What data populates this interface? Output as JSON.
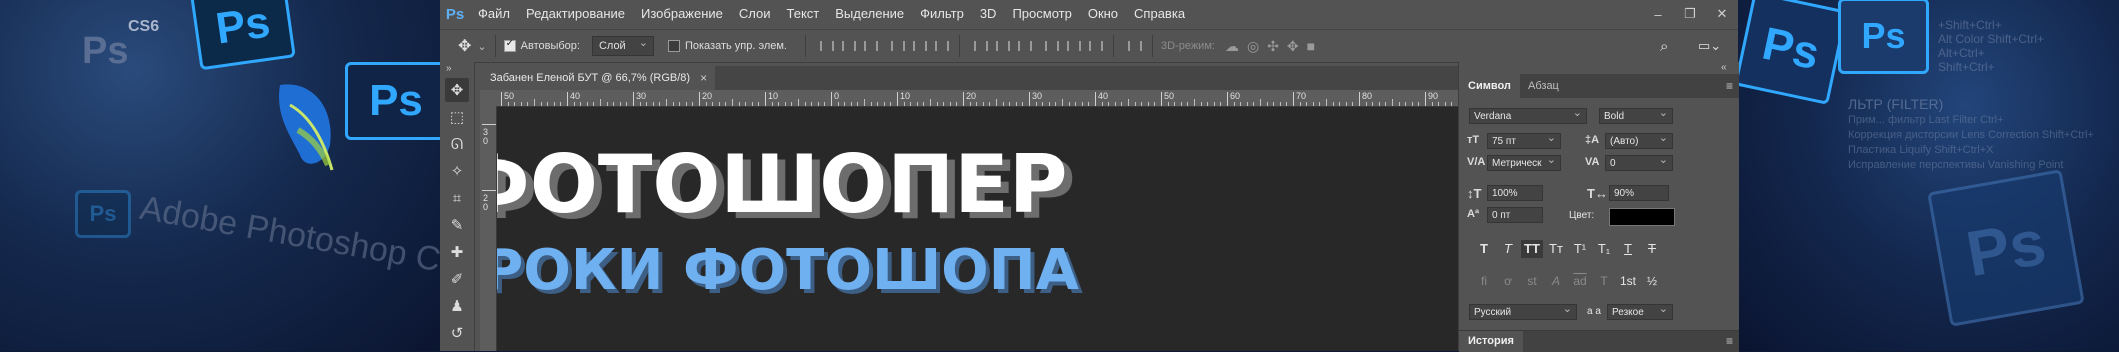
{
  "background": {
    "left_badges": [
      "CS6",
      "Ps",
      "Ps",
      "Ps",
      "Ps"
    ],
    "left_text": "Adobe Photoshop C",
    "right_badges": [
      "Ps",
      "Ps",
      "Ps"
    ],
    "right_text_lines": [
      "+Shift+Ctrl+",
      "Alt Color Shift+Ctrl+",
      "Alt+Ctrl+",
      "Shift+Ctrl+",
      "ЛЬТР (FILTER)",
      "Прим... фильтр  Last Filter  Ctrl+",
      "Коррекция дисторсии  Lens Correction  Shift+Ctrl+",
      "Пластика  Liquify  Shift+Ctrl+X",
      "Исправление перспективы  Vanishing Point"
    ]
  },
  "menubar": {
    "logo": "Ps",
    "items": [
      "Файл",
      "Редактирование",
      "Изображение",
      "Слои",
      "Текст",
      "Выделение",
      "Фильтр",
      "3D",
      "Просмотр",
      "Окно",
      "Справка"
    ],
    "window_controls": [
      "–",
      "❐",
      "✕"
    ]
  },
  "options": {
    "autoselect_label": "Автовыбор:",
    "autoselect_checked": true,
    "autoselect_target": "Слой",
    "show_transform_label": "Показать упр. элем.",
    "show_transform_checked": false,
    "mode3d_label": "3D-режим:"
  },
  "document": {
    "tab_title": "Забанен Еленой БУТ @ 66,7% (RGB/8)",
    "tab_close": "×",
    "ruler_h_ticks": [
      "50",
      "40",
      "30",
      "20",
      "10",
      "0",
      "10",
      "20",
      "30",
      "40",
      "50",
      "60",
      "70",
      "80",
      "90"
    ],
    "ruler_v_ticks": [
      "3 0",
      "2 0"
    ],
    "headline": "ФОТОШОПЕР",
    "subheadline": "УРОКИ ФОТОШОПА",
    "headline_color": "#ffffff",
    "subheadline_color": "#6fb0f0"
  },
  "character_panel": {
    "tabs": [
      "Символ",
      "Абзац"
    ],
    "font_family": "Verdana",
    "font_style": "Bold",
    "font_size": "75 пт",
    "leading": "(Авто)",
    "kerning": "Метрическ",
    "tracking": "0",
    "vertical_scale": "100%",
    "horizontal_scale": "90%",
    "baseline_shift": "0 пт",
    "color_label": "Цвет:",
    "color_value": "#000000",
    "style_buttons": [
      "T",
      "T",
      "TT",
      "Tт",
      "T¹",
      "T₁",
      "T",
      "T"
    ],
    "opentype_buttons": [
      "fi",
      "ơ",
      "st",
      "A",
      "ad",
      "T",
      "1st",
      "½"
    ],
    "language": "Русский",
    "aa_label": "a a",
    "antialias": "Резкое",
    "history_tab": "История"
  },
  "colors": {
    "ui_gray": "#535353",
    "canvas": "#282828",
    "accent_blue": "#31a8ff"
  }
}
